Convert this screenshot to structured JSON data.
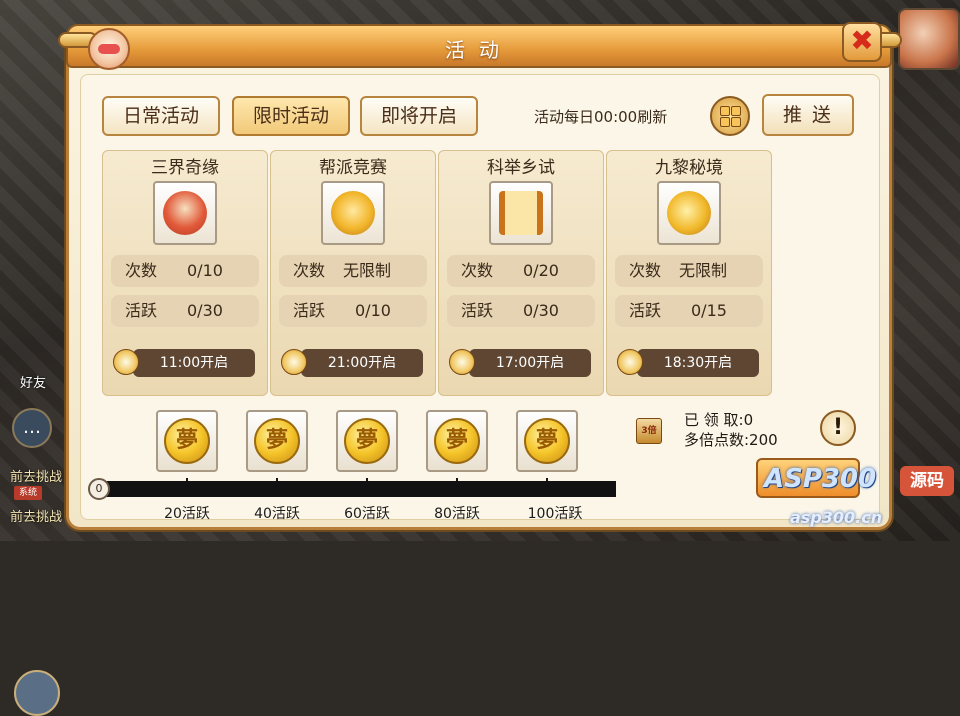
{
  "window": {
    "title": "活动",
    "close_icon": "✖"
  },
  "tabs": [
    {
      "label": "日常活动",
      "active": false
    },
    {
      "label": "限时活动",
      "active": true
    },
    {
      "label": "即将开启",
      "active": false
    }
  ],
  "refresh_text": "活动每日00:00刷新",
  "push_label": "推送",
  "cards": [
    {
      "title": "三界奇缘",
      "icon": "bowl-icon",
      "count_label": "次数",
      "count_value": "0/10",
      "active_label": "活跃",
      "active_value": "0/30",
      "time": "11:00开启"
    },
    {
      "title": "帮派竞赛",
      "icon": "gift-pouch-icon",
      "count_label": "次数",
      "count_value": "无限制",
      "active_label": "活跃",
      "active_value": "0/10",
      "time": "21:00开启"
    },
    {
      "title": "科举乡试",
      "icon": "scroll-icon",
      "count_label": "次数",
      "count_value": "0/20",
      "active_label": "活跃",
      "active_value": "0/30",
      "time": "17:00开启"
    },
    {
      "title": "九黎秘境",
      "icon": "golden-ornament-icon",
      "count_label": "次数",
      "count_value": "无限制",
      "active_label": "活跃",
      "active_value": "0/15",
      "time": "18:30开启"
    }
  ],
  "progress": {
    "start_value": "0",
    "current_fraction": 0,
    "milestones": [
      "20活跃",
      "40活跃",
      "60活跃",
      "80活跃",
      "100活跃"
    ]
  },
  "bonus": {
    "icon_text": "3倍",
    "claimed_line": "已 领 取:0",
    "multiplier_line": "多倍点数:200"
  },
  "left_side": {
    "friend_label": "好友",
    "challenge_1": "前去挑战",
    "challenge_2": "前去挑战",
    "badge": "系统"
  },
  "watermark": {
    "brand": "ASP300",
    "tag": "源码",
    "url": "asp300.cn"
  },
  "colors": {
    "accent": "#e59a3a",
    "panel": "#fbf4e2",
    "time_bar": "#5e4632"
  }
}
